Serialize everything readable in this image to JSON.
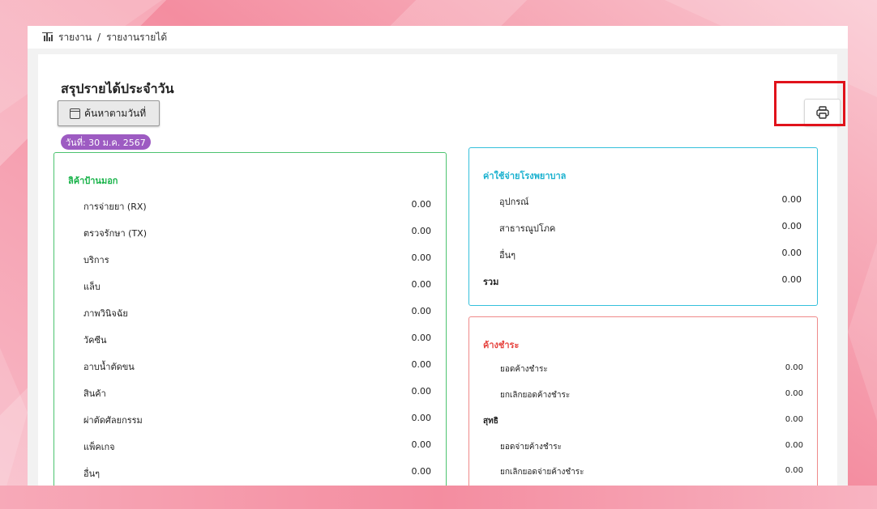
{
  "breadcrumb": {
    "root": "รายงาน",
    "separator": "/",
    "current": "รายงานรายได้"
  },
  "page": {
    "title": "สรุปรายได้ประจำวัน"
  },
  "filter": {
    "search_button_label": "ค้นหาตามวันที่",
    "date_badge": "วันที่: 30 ม.ค. 2567"
  },
  "colors": {
    "accent_purple": "#9d5bc2",
    "green": "#19b34a",
    "cyan": "#1ab1cf",
    "red": "#e6443f",
    "highlight": "#e0121b"
  },
  "opd_income": {
    "title": "ลิค้าป้านมอก",
    "rows": [
      {
        "label": "การจ่ายยา (RX)",
        "value": "0.00"
      },
      {
        "label": "ตรวจรักษา (TX)",
        "value": "0.00"
      },
      {
        "label": "บริการ",
        "value": "0.00"
      },
      {
        "label": "แล็บ",
        "value": "0.00"
      },
      {
        "label": "ภาพวินิจฉัย",
        "value": "0.00"
      },
      {
        "label": "วัคซีน",
        "value": "0.00"
      },
      {
        "label": "อาบน้ำตัดขน",
        "value": "0.00"
      },
      {
        "label": "สินค้า",
        "value": "0.00"
      },
      {
        "label": "ผ่าตัดศัลยกรรม",
        "value": "0.00"
      },
      {
        "label": "แพ็คเกจ",
        "value": "0.00"
      },
      {
        "label": "อื่นๆ",
        "value": "0.00"
      }
    ]
  },
  "hospital_expenses": {
    "title": "ค่าใช้จ่ายโรงพยาบาล",
    "rows": [
      {
        "label": "อุปกรณ์",
        "value": "0.00"
      },
      {
        "label": "สาธารณูปโภค",
        "value": "0.00"
      },
      {
        "label": "อื่นๆ",
        "value": "0.00"
      }
    ],
    "total": {
      "label": "รวม",
      "value": "0.00"
    }
  },
  "outstanding": {
    "title": "ค้างชำระ",
    "rows": [
      {
        "label": "ยอดค้างชำระ",
        "value": "0.00"
      },
      {
        "label": "ยกเลิกยอดค้างชำระ",
        "value": "0.00"
      }
    ],
    "net": {
      "label": "สุทธิ",
      "value": "0.00"
    },
    "rows2": [
      {
        "label": "ยอดจ่ายค้างชำระ",
        "value": "0.00"
      },
      {
        "label": "ยกเลิกยอดจ่ายค้างชำระ",
        "value": "0.00"
      }
    ]
  }
}
